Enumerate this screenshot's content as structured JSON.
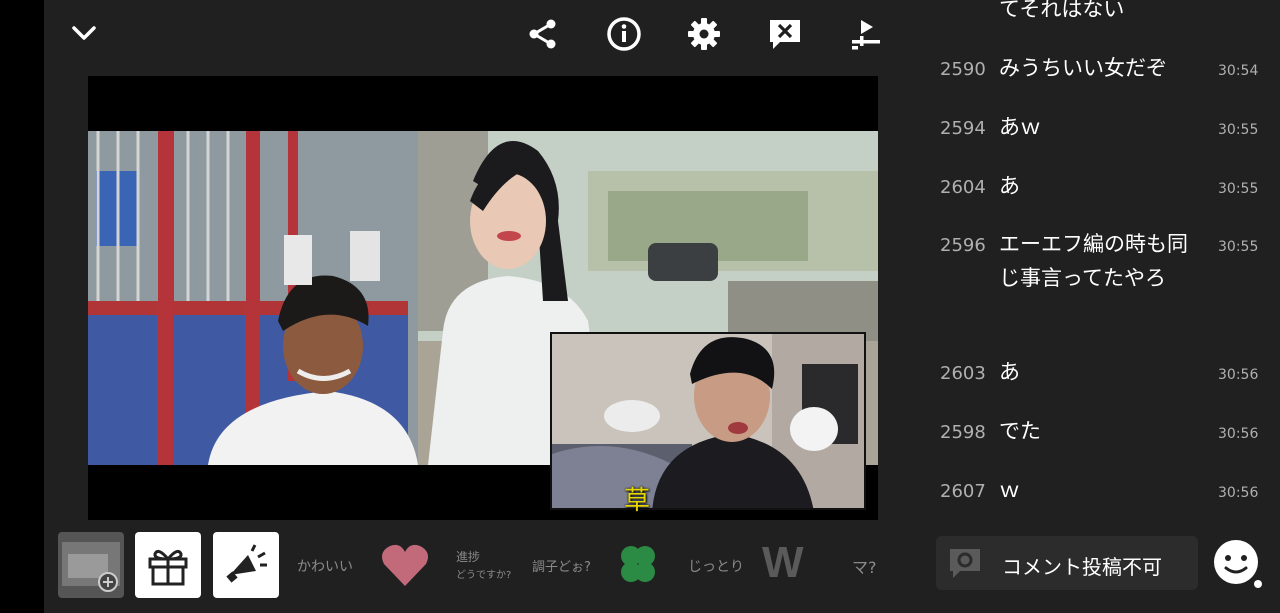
{
  "chat": {
    "partial_top": "てそれはない",
    "messages": [
      {
        "num": "2590",
        "text": "みうちいい女だぞ",
        "time": "30:54"
      },
      {
        "num": "2594",
        "text": "あｗ",
        "time": "30:55"
      },
      {
        "num": "2604",
        "text": "あ",
        "time": "30:55"
      },
      {
        "num": "2596",
        "text": "エーエフ編の時も同じ事言ってたやろ",
        "time": "30:55"
      },
      {
        "num": "2603",
        "text": "あ",
        "time": "30:56"
      },
      {
        "num": "2598",
        "text": "でた",
        "time": "30:56"
      },
      {
        "num": "2607",
        "text": "ｗ",
        "time": "30:56"
      }
    ]
  },
  "video": {
    "pip_caption": "草"
  },
  "reactions": {
    "kawaii": "かわいい",
    "shinchoku_top": "進捗",
    "shinchoku_bottom": "どうですか?",
    "choushi": "調子どぉ?",
    "jittori": "じっとり",
    "w_symbol": "W",
    "ma": "マ?"
  },
  "comment": {
    "label": "コメント投稿不可"
  },
  "colors": {
    "panel": "#202020",
    "heart": "#c26a7a",
    "clover": "#2b8a43",
    "caption": "#e6d700"
  },
  "icons": [
    "chevron-down-icon",
    "share-icon",
    "info-icon",
    "gear-icon",
    "comment-off-icon",
    "playlist-icon",
    "gift-icon",
    "megaphone-icon",
    "heart-icon",
    "clover-icon",
    "smiley-icon"
  ]
}
